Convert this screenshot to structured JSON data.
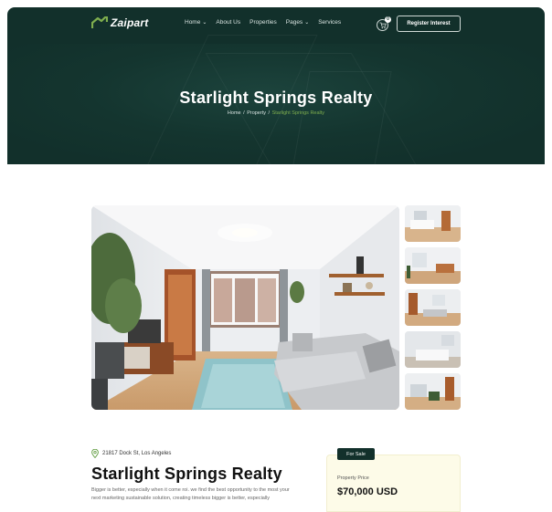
{
  "nav": {
    "logo_text": "Zaipart",
    "items": [
      {
        "label": "Home",
        "dropdown": true
      },
      {
        "label": "About Us",
        "dropdown": false
      },
      {
        "label": "Properties",
        "dropdown": false
      },
      {
        "label": "Pages",
        "dropdown": true
      },
      {
        "label": "Services",
        "dropdown": false
      }
    ],
    "cart_count": "0",
    "register_label": "Register Interest"
  },
  "hero": {
    "title": "Starlight Springs Realty",
    "breadcrumb": [
      "Home",
      "Property",
      "Starlight Springs Realty"
    ]
  },
  "gallery": {
    "thumbnail_count": 5
  },
  "listing": {
    "address": "21817 Dock St, Los Angeles",
    "title": "Starlight Springs Realty",
    "description": "Bigger is better, especially when it come roi. we find the best opportunity to the most your next marketing sustainable solution, creating timeless bigger is better, especially",
    "badge": "For Sale",
    "price_label": "Property Price",
    "price": "$70,000 USD"
  },
  "colors": {
    "brand_dark": "#12302b",
    "accent_green": "#7fae4e",
    "card_bg": "#fdfbe8"
  }
}
